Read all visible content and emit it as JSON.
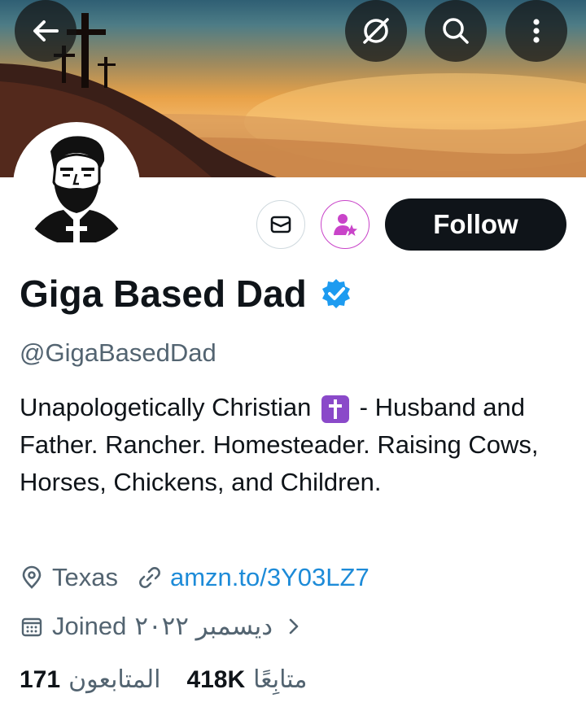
{
  "profile": {
    "name": "Giga Based Dad",
    "handle": "@GigaBasedDad",
    "bio_part1": "Unapologetically Christian",
    "bio_emoji": "✝️",
    "bio_part2": "- Husband and Father. Rancher. Homesteader. Raising Cows, Horses, Chickens, and Children.",
    "location": "Texas",
    "website": "amzn.to/3Y03LZ7",
    "joined_label": "Joined",
    "joined_date": "ديسمبر ٢٠٢٢",
    "following_count": "171",
    "following_label": "المتابعون",
    "followers_count": "418K",
    "followers_label": "متابِعًا"
  },
  "actions": {
    "follow_label": "Follow"
  },
  "icons": {
    "back": "arrow-left-icon",
    "grok": "grok-icon",
    "search": "search-icon",
    "more": "more-vertical-icon",
    "message": "envelope-icon",
    "subscribe": "subscribe-star-icon",
    "verified": "verified-badge-icon",
    "location": "location-pin-icon",
    "link": "link-icon",
    "calendar": "calendar-icon",
    "chevron": "chevron-right-icon"
  },
  "colors": {
    "verified": "#1d9bf0",
    "link": "#1d8bd8",
    "follow_bg": "#0f1419",
    "subscribe": "#c944c9",
    "muted": "#536471"
  }
}
